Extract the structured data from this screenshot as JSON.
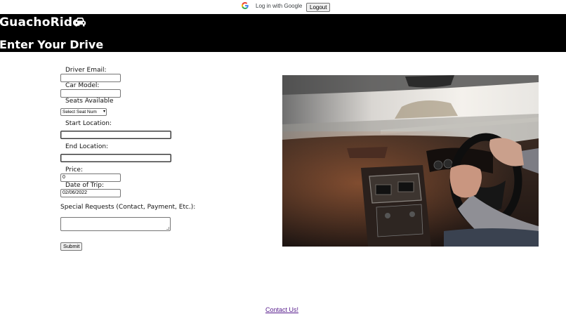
{
  "auth": {
    "google_label": "Log in with Google",
    "logout_label": "Logout"
  },
  "header": {
    "brand": "GuachoRide",
    "brand_icon": "car-icon",
    "subtitle": "Enter Your Drive",
    "background": "#000000",
    "text_color": "#ffffff"
  },
  "form": {
    "driver_email": {
      "label": "Driver Email:",
      "value": ""
    },
    "car_model": {
      "label": "Car Model:",
      "value": ""
    },
    "seats": {
      "label": "Seats Available",
      "selected": "Select Seat Num"
    },
    "start_location": {
      "label": "Start Location:",
      "value": ""
    },
    "end_location": {
      "label": "End Location:",
      "value": ""
    },
    "price": {
      "label": "Price:",
      "value": "0"
    },
    "date": {
      "label": "Date of Trip:",
      "value": "02/06/2022"
    },
    "special_requests": {
      "label": "Special Requests (Contact, Payment, Etc.):",
      "value": ""
    },
    "submit_label": "Submit"
  },
  "footer": {
    "contact_label": "Contact Us!",
    "link_color": "#551a8b"
  },
  "image": {
    "subject": "driver-hands-on-steering-wheel-photo"
  }
}
